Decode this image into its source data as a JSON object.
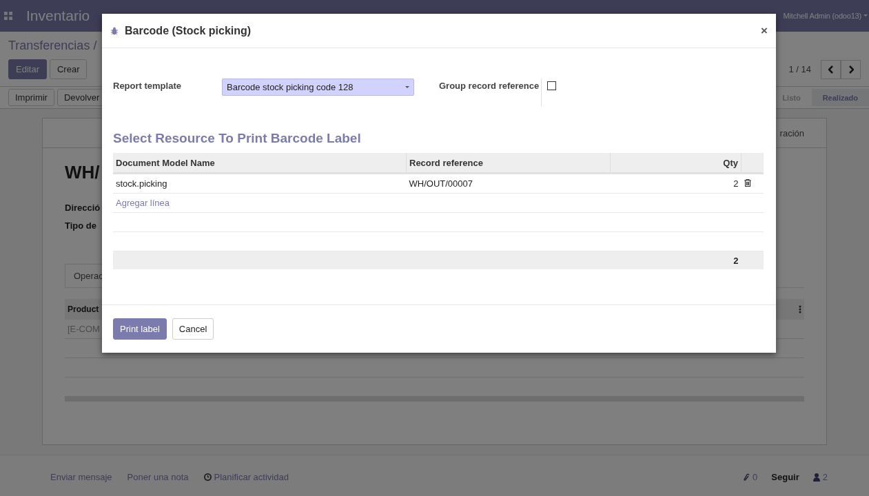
{
  "navbar": {
    "app_name": "Inventario",
    "user": "Mitchell Admin (odoo13)"
  },
  "control_panel": {
    "breadcrumb": "Transferencias /",
    "buttons": [
      {
        "label": "Editar",
        "primary": true
      },
      {
        "label": "Crear",
        "primary": false
      }
    ],
    "actions": [
      "Imprimir",
      "Devolver"
    ],
    "pager": "1 / 14",
    "steps": [
      {
        "label": "Listo",
        "selected": false
      },
      {
        "label": "Realizado",
        "selected": true
      }
    ]
  },
  "sheet": {
    "smart_button": "ración",
    "title": "WH/",
    "labels": [
      "Direcció",
      "Tipo de"
    ],
    "tab": "Operac",
    "column": "Product",
    "row": "[E-COM"
  },
  "chatter": {
    "actions": [
      "Enviar mensaje",
      "Poner una nota",
      "Planificar actividad"
    ],
    "attachments": "0",
    "follow": "Seguir",
    "followers": "2"
  },
  "modal": {
    "title": "Barcode (Stock picking)",
    "close": "×",
    "report_template": {
      "label": "Report template",
      "value": "Barcode stock picking code 128"
    },
    "group_reference": {
      "label": "Group record reference",
      "checked": false
    },
    "section_title": "Select Resource To Print Barcode Label",
    "table": {
      "columns": [
        "Document Model Name",
        "Record reference",
        "Qty"
      ],
      "rows": [
        {
          "model": "stock.picking",
          "reference": "WH/OUT/00007",
          "qty": "2"
        }
      ],
      "add_line": "Agregar línea",
      "total": "2"
    },
    "buttons": [
      {
        "label": "Print label",
        "primary": true
      },
      {
        "label": "Cancel",
        "primary": false
      }
    ]
  }
}
